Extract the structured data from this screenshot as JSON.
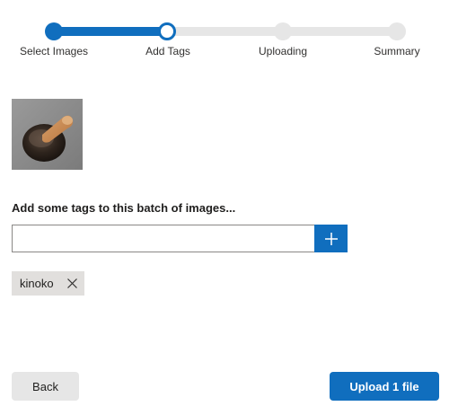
{
  "stepper": {
    "steps": [
      {
        "label": "Select Images",
        "state": "done"
      },
      {
        "label": "Add Tags",
        "state": "current"
      },
      {
        "label": "Uploading",
        "state": "todo"
      },
      {
        "label": "Summary",
        "state": "todo"
      }
    ]
  },
  "thumbnail": {
    "icon": "image-thumbnail"
  },
  "tags": {
    "prompt": "Add some tags to this batch of images...",
    "input_value": "",
    "input_placeholder": "",
    "add_icon": "plus-icon",
    "items": [
      {
        "label": "kinoko",
        "remove_icon": "close-icon"
      }
    ]
  },
  "footer": {
    "back_label": "Back",
    "upload_label": "Upload 1 file"
  },
  "colors": {
    "accent": "#106ebe",
    "track": "#e6e6e6",
    "chip": "#e1dfdd"
  }
}
